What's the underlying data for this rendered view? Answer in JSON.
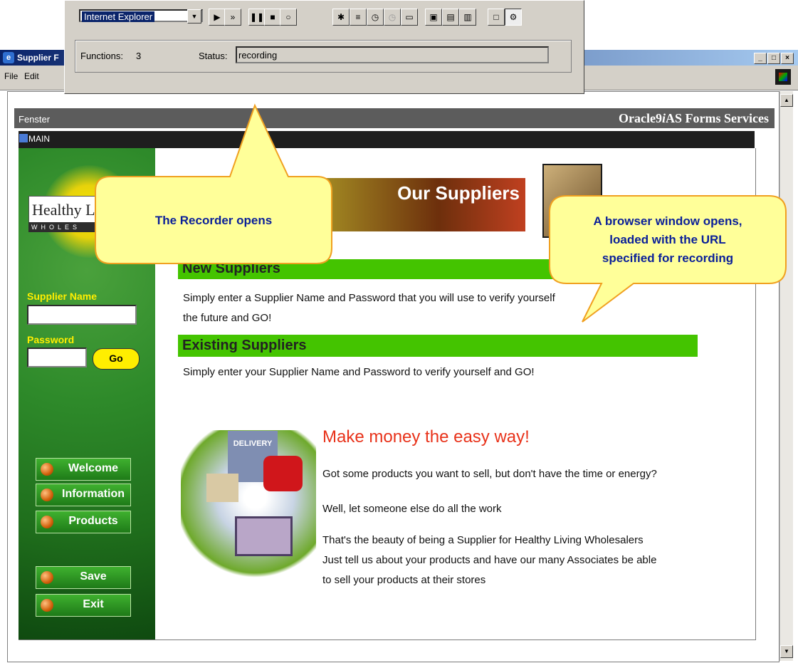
{
  "browser": {
    "title": "Supplier F",
    "menu": [
      "File",
      "Edit"
    ],
    "window_buttons": [
      "_",
      "□",
      "×"
    ]
  },
  "recorder": {
    "browser_select": "Internet Explorer",
    "functions_label": "Functions:",
    "functions_count": "3",
    "status_label": "Status:",
    "status_value": "recording",
    "buttons": [
      "play",
      "step",
      "pause",
      "stop",
      "record",
      "functions",
      "checkpoint",
      "timer",
      "timer-disabled",
      "open",
      "save",
      "export",
      "report",
      "window",
      "settings"
    ]
  },
  "forms": {
    "window_label": "Fenster",
    "title_prefix": "Oracle9",
    "title_em": "i",
    "title_suffix": "AS Forms Services",
    "main_label": "MAIN"
  },
  "sidebar": {
    "logo_text": "Healthy L",
    "logo_subtext": "WHOLES",
    "supplier_name_label": "Supplier Name",
    "supplier_name_value": "",
    "password_label": "Password",
    "password_value": "",
    "go_label": "Go",
    "nav": [
      {
        "label": "Welcome"
      },
      {
        "label": "Information"
      },
      {
        "label": "Products"
      },
      {
        "label": "Save"
      },
      {
        "label": "Exit"
      }
    ]
  },
  "content": {
    "banner_title": "Our Suppliers",
    "new_suppliers_title": "New Suppliers",
    "new_suppliers_line1": "Simply enter a Supplier Name and Password that you will use to verify yourself",
    "new_suppliers_line2": "the future and GO!",
    "existing_suppliers_title": "Existing Suppliers",
    "existing_suppliers_text": "Simply enter your Supplier Name and Password to verify yourself and GO!",
    "headline": "Make money the easy way!",
    "para1": "Got some products you want to sell, but don't have the time or energy?",
    "para2": "Well, let someone else do all the work",
    "para3_line1": "That's the beauty of being a Supplier for Healthy Living Wholesalers",
    "para3_line2": "Just tell us about your products and have our many Associates be able",
    "para3_line3": "to sell your products at their stores",
    "truck_label": "DELIVERY"
  },
  "callouts": {
    "recorder": "The Recorder opens",
    "browser_line1": "A browser window opens,",
    "browser_line2": "loaded with the URL",
    "browser_line3": "specified for recording"
  },
  "colors": {
    "callout_fill": "#ffff99",
    "callout_border": "#f0a020",
    "callout_text": "#0a1f99",
    "green_bar": "#44c400",
    "headline": "#e8321a"
  }
}
